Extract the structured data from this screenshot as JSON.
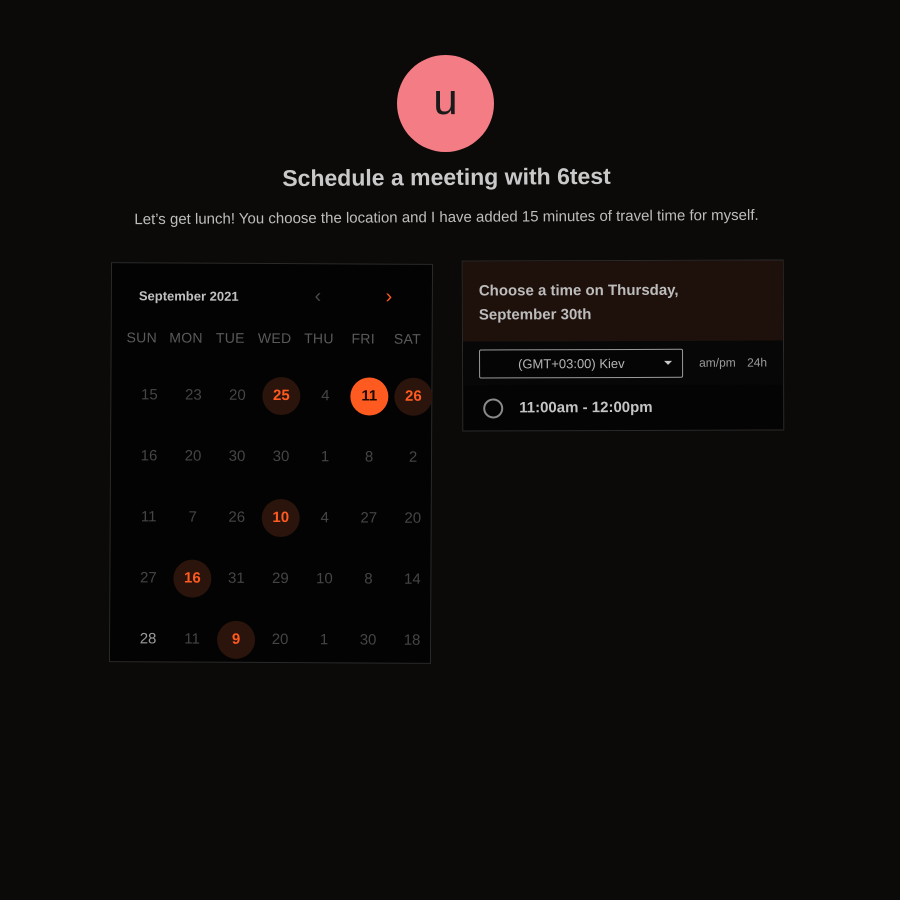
{
  "header": {
    "avatar_letter": "u",
    "avatar_color": "#f47d85",
    "title": "Schedule a meeting with 6test",
    "subtitle": "Let’s get lunch! You choose the location and I have added 15 minutes of travel time for myself."
  },
  "calendar": {
    "month_label": "September 2021",
    "prev_icon": "chevron-left-icon",
    "next_icon": "chevron-right-icon",
    "accent_color": "#ff5a1f",
    "weekdays": [
      "SUN",
      "MON",
      "TUE",
      "WED",
      "THU",
      "FRI",
      "SAT"
    ],
    "days": [
      {
        "label": "15",
        "state": "disabled"
      },
      {
        "label": "23",
        "state": "disabled"
      },
      {
        "label": "20",
        "state": "disabled"
      },
      {
        "label": "25",
        "state": "available"
      },
      {
        "label": "4",
        "state": "disabled"
      },
      {
        "label": "11",
        "state": "selected"
      },
      {
        "label": "26",
        "state": "available"
      },
      {
        "label": "16",
        "state": "disabled"
      },
      {
        "label": "20",
        "state": "disabled"
      },
      {
        "label": "30",
        "state": "disabled"
      },
      {
        "label": "30",
        "state": "disabled"
      },
      {
        "label": "1",
        "state": "disabled"
      },
      {
        "label": "8",
        "state": "disabled"
      },
      {
        "label": "2",
        "state": "disabled"
      },
      {
        "label": "11",
        "state": "disabled"
      },
      {
        "label": "7",
        "state": "disabled"
      },
      {
        "label": "26",
        "state": "disabled"
      },
      {
        "label": "10",
        "state": "available"
      },
      {
        "label": "4",
        "state": "disabled"
      },
      {
        "label": "27",
        "state": "disabled"
      },
      {
        "label": "20",
        "state": "disabled"
      },
      {
        "label": "27",
        "state": "disabled"
      },
      {
        "label": "16",
        "state": "available"
      },
      {
        "label": "31",
        "state": "disabled"
      },
      {
        "label": "29",
        "state": "disabled"
      },
      {
        "label": "10",
        "state": "disabled"
      },
      {
        "label": "8",
        "state": "disabled"
      },
      {
        "label": "14",
        "state": "disabled"
      },
      {
        "label": "28",
        "state": "bright"
      },
      {
        "label": "11",
        "state": "disabled"
      },
      {
        "label": "9",
        "state": "available"
      },
      {
        "label": "20",
        "state": "disabled"
      },
      {
        "label": "1",
        "state": "disabled"
      },
      {
        "label": "30",
        "state": "disabled"
      },
      {
        "label": "18",
        "state": "disabled"
      }
    ]
  },
  "timepanel": {
    "heading": "Choose a time on Thursday, September 30th",
    "timezone_value": "(GMT+03:00) Kiev",
    "format_ampm": "am/pm",
    "format_24h": "24h",
    "slots": [
      {
        "label": "11:00am - 12:00pm"
      }
    ]
  }
}
